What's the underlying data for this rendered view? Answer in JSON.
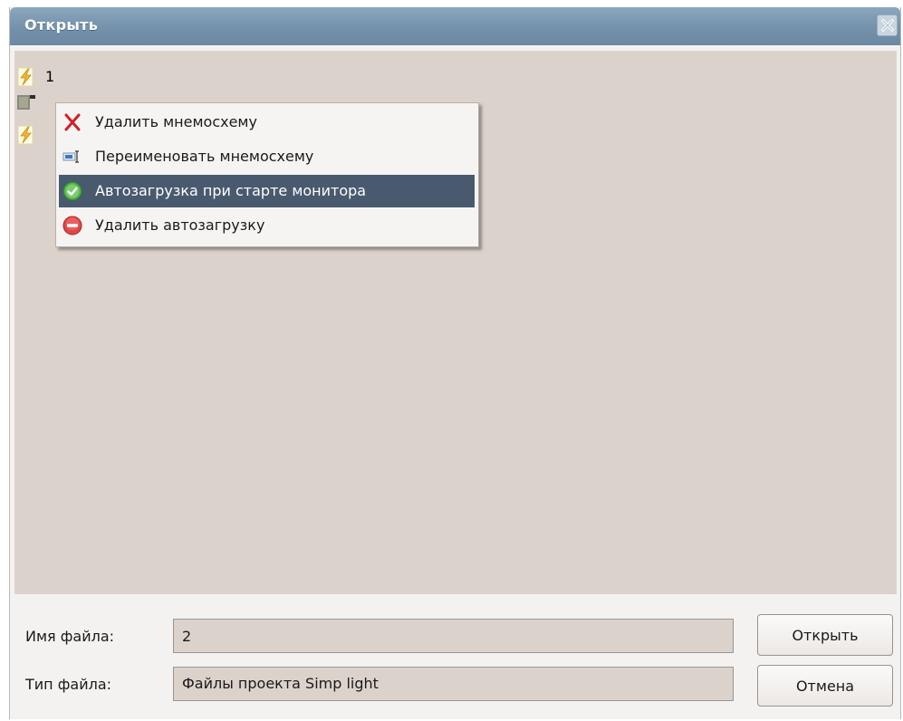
{
  "dialog": {
    "title": "Открыть"
  },
  "tree": {
    "items": [
      {
        "label": "1",
        "icon": "lightning-file-icon"
      },
      {
        "label": "",
        "icon": "folder-icon"
      },
      {
        "label": "",
        "icon": "lightning-file-icon"
      }
    ]
  },
  "context_menu": {
    "items": [
      {
        "label": "Удалить мнемосхему",
        "icon": "red-x-delete-icon"
      },
      {
        "label": "Переименовать мнемосхему",
        "icon": "rename-icon"
      },
      {
        "label": "Автозагрузка при старте монитора",
        "icon": "green-check-icon",
        "highlighted": true
      },
      {
        "label": "Удалить автозагрузку",
        "icon": "red-minus-icon"
      }
    ]
  },
  "footer": {
    "filename_label": "Имя файла:",
    "filename_value": "2",
    "filetype_label": "Тип файла:",
    "filetype_value": "Файлы проекта Simp light",
    "open_button": "Открыть",
    "cancel_button": "Отмена"
  },
  "colors": {
    "titlebar": "#7491ab",
    "pane": "#dcd2cc",
    "menu_highlight": "#495a6e"
  }
}
